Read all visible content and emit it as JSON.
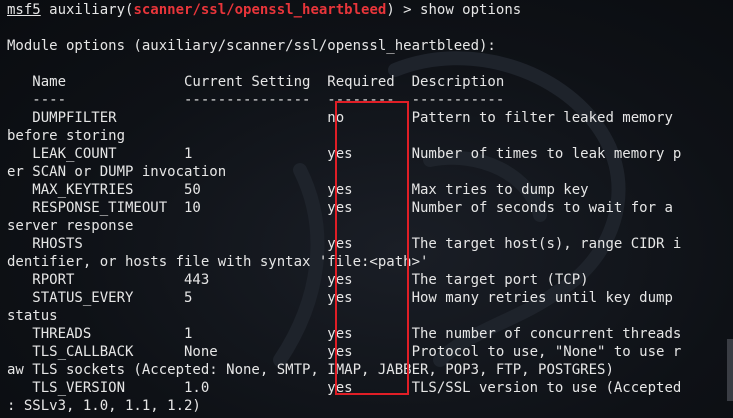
{
  "prompt": {
    "msf": "msf5",
    "pre": " auxiliary(",
    "module": "scanner/ssl/openssl_heartbleed",
    "post": ") > show options"
  },
  "lines": [
    "",
    "Module options (auxiliary/scanner/ssl/openssl_heartbleed):",
    "",
    "   Name              Current Setting  Required  Description",
    "   ----              ---------------  --------  -----------",
    "   DUMPFILTER                         no        Pattern to filter leaked memory",
    "before storing",
    "   LEAK_COUNT        1                yes       Number of times to leak memory p",
    "er SCAN or DUMP invocation",
    "   MAX_KEYTRIES      50               yes       Max tries to dump key",
    "   RESPONSE_TIMEOUT  10               yes       Number of seconds to wait for a",
    "server response",
    "   RHOSTS                             yes       The target host(s), range CIDR i",
    "dentifier, or hosts file with syntax 'file:<path>'",
    "   RPORT             443              yes       The target port (TCP)",
    "   STATUS_EVERY      5                yes       How many retries until key dump",
    "status",
    "   THREADS           1                yes       The number of concurrent threads",
    "   TLS_CALLBACK      None             yes       Protocol to use, \"None\" to use r",
    "aw TLS sockets (Accepted: None, SMTP, IMAP, JABBER, POP3, FTP, POSTGRES)",
    "   TLS_VERSION       1.0              yes       TLS/SSL version to use (Accepted",
    ": SSLv3, 1.0, 1.1, 1.2)"
  ],
  "colors": {
    "module": "#e8353a",
    "highlight_box": "#e01e26",
    "text": "#e6e6e6"
  }
}
